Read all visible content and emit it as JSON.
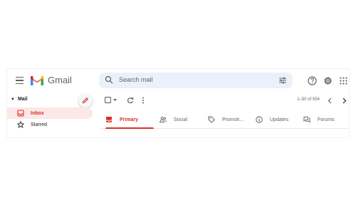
{
  "header": {
    "brand": "Gmail",
    "search_placeholder": "Search mail",
    "icons": [
      "menu-icon",
      "help-icon",
      "settings-icon",
      "apps-icon"
    ]
  },
  "sidebar": {
    "section_label": "Mail",
    "items": [
      {
        "label": "Inbox",
        "icon": "inbox-icon",
        "active": true
      },
      {
        "label": "Starred",
        "icon": "star-icon",
        "active": false
      }
    ]
  },
  "toolbar": {
    "count": "1–50 of 554"
  },
  "tabs": [
    {
      "label": "Primary",
      "icon": "inbox-icon",
      "active": true
    },
    {
      "label": "Social",
      "icon": "people-icon",
      "active": false
    },
    {
      "label": "Promoti…",
      "icon": "tag-icon",
      "active": false
    },
    {
      "label": "Updates",
      "icon": "info-icon",
      "active": false
    },
    {
      "label": "Forums",
      "icon": "forum-icon",
      "active": false
    }
  ],
  "colors": {
    "accent": "#d93025",
    "active_bg": "#fce8e6",
    "search_bg": "#eaf1fb"
  }
}
